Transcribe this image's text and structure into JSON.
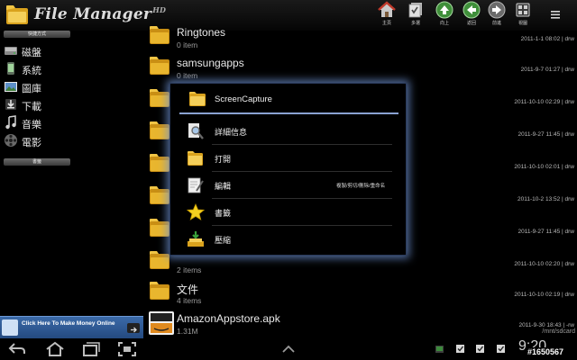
{
  "app": {
    "title": "File Manager",
    "edition": "HD"
  },
  "toolbar": {
    "buttons": [
      {
        "id": "home",
        "label": "主頁",
        "icon": "house-icon"
      },
      {
        "id": "multi",
        "label": "多選",
        "icon": "multi-select-icon"
      },
      {
        "id": "up",
        "label": "向上",
        "icon": "arrow-up-icon"
      },
      {
        "id": "back",
        "label": "返回",
        "icon": "arrow-left-icon"
      },
      {
        "id": "forward",
        "label": "前進",
        "icon": "arrow-right-icon"
      },
      {
        "id": "view",
        "label": "視圖",
        "icon": "view-icon"
      }
    ]
  },
  "sidebar": {
    "quick_header": "快捷方式",
    "items": [
      {
        "label": "磁盤",
        "icon": "disk-icon"
      },
      {
        "label": "系統",
        "icon": "phone-icon"
      },
      {
        "label": "圖庫",
        "icon": "gallery-icon"
      },
      {
        "label": "下載",
        "icon": "download-icon"
      },
      {
        "label": "音樂",
        "icon": "music-icon"
      },
      {
        "label": "電影",
        "icon": "movie-icon"
      }
    ],
    "bookmark_header": "書籤"
  },
  "ad": {
    "text": "Click Here To Make Money Online"
  },
  "files": [
    {
      "name": "Ringtones",
      "meta": "0 item",
      "date": "2011-1-1 08:02 | drw"
    },
    {
      "name": "samsungapps",
      "meta": "0 item",
      "date": "2011-9-7 01:27 | drw"
    },
    {
      "name": "",
      "meta": "",
      "date": "2011-10-10 02:29 | drw"
    },
    {
      "name": "",
      "meta": "",
      "date": "2011-9-27 11:45 | drw"
    },
    {
      "name": "",
      "meta": "",
      "date": "2011-10-10 02:01 | drw"
    },
    {
      "name": "",
      "meta": "",
      "date": "2011-10-2 13:52 | drw"
    },
    {
      "name": "",
      "meta": "",
      "date": "2011-9-27 11:45 | drw"
    },
    {
      "name": "",
      "meta": "2 items",
      "date": "2011-10-10 02:20 | drw"
    },
    {
      "name": "文件",
      "meta": "4 items",
      "date": "2011-10-10 02:19 | drw"
    },
    {
      "name": "AmazonAppstore.apk",
      "meta": "1.31M",
      "date": "2011-9-30 18:43 | -rw"
    }
  ],
  "path": "/mnt/sdcard",
  "dialog": {
    "title": "ScreenCapture",
    "items": [
      {
        "label": "詳細信息",
        "icon": "magnifier-icon",
        "sub": ""
      },
      {
        "label": "打開",
        "icon": "folder-open-icon",
        "sub": ""
      },
      {
        "label": "編輯",
        "icon": "edit-icon",
        "sub": "複製/剪切/刪除/重命名"
      },
      {
        "label": "書籤",
        "icon": "star-icon",
        "sub": ""
      },
      {
        "label": "壓縮",
        "icon": "compress-icon",
        "sub": ""
      }
    ]
  },
  "status": {
    "clock": "9:20"
  },
  "watermark": "#1650567",
  "colors": {
    "accent": "#8aa2d2",
    "folder": "#e7b028",
    "dialog_glow": "#6e91d2"
  }
}
